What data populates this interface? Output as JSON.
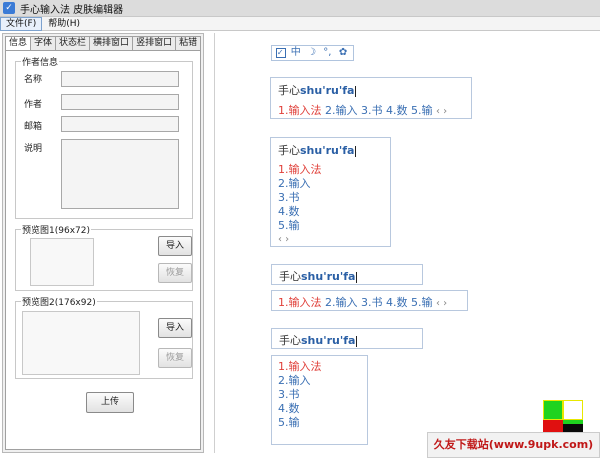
{
  "window": {
    "title": "手心输入法 皮肤编辑器"
  },
  "menu": {
    "items": [
      "文件(F)",
      "帮助(H)"
    ]
  },
  "tabs": [
    "信息",
    "字体",
    "状态栏",
    "横排窗口",
    "竖排窗口",
    "粘错"
  ],
  "info": {
    "author_group": "作者信息",
    "labels": {
      "name": "名称",
      "author": "作者",
      "email": "邮箱",
      "desc": "说明"
    },
    "preview1": {
      "title": "预览图1(96x72)",
      "import": "导入",
      "restore": "恢复"
    },
    "preview2": {
      "title": "预览图2(176x92)",
      "import": "导入",
      "restore": "恢复"
    },
    "upload": "上传"
  },
  "toolbar": {
    "icons": [
      "checkbox-icon",
      "chinese-mode-icon",
      "moon-icon",
      "punctuation-icon",
      "gear-icon"
    ],
    "zh": "中",
    "moon": "☽",
    "punct": "°,",
    "gear": "✿",
    "check": "✓"
  },
  "ime": {
    "prefix": "手心",
    "pinyin": "shu'ru'fa",
    "candidates": [
      "1.输入法",
      "2.输入",
      "3.书",
      "4.数",
      "5.输"
    ],
    "arrows": "‹ ›"
  },
  "watermark": "久友下载站(www.9upk.com)",
  "colors": {
    "accent": "#3a6fb3",
    "highlight": "#e0403a",
    "border": "#b8c8de"
  }
}
